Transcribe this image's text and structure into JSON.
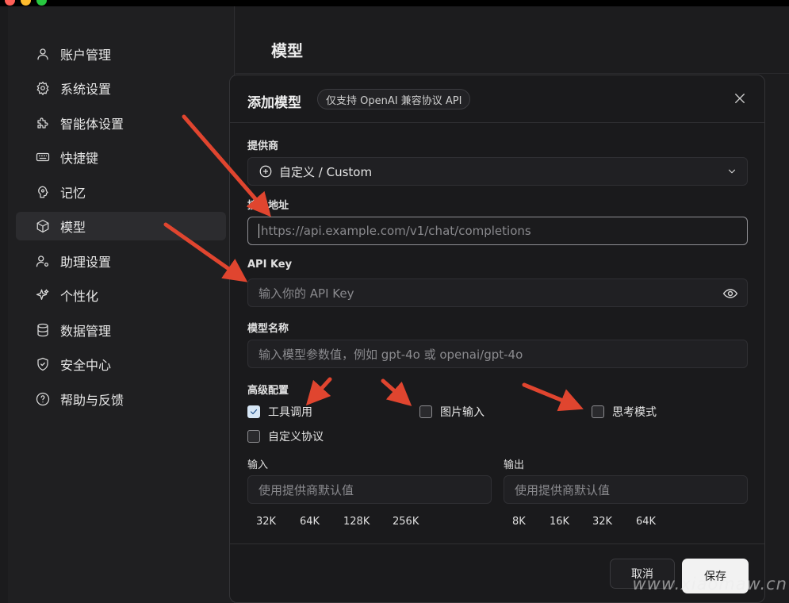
{
  "sidebar": {
    "items": [
      {
        "label": "账户管理",
        "icon": "user-icon"
      },
      {
        "label": "系统设置",
        "icon": "gear-icon"
      },
      {
        "label": "智能体设置",
        "icon": "puzzle-icon"
      },
      {
        "label": "快捷键",
        "icon": "keyboard-icon"
      },
      {
        "label": "记忆",
        "icon": "brain-icon"
      },
      {
        "label": "模型",
        "icon": "cube-icon"
      },
      {
        "label": "助理设置",
        "icon": "user-gear-icon"
      },
      {
        "label": "个性化",
        "icon": "sparkles-icon"
      },
      {
        "label": "数据管理",
        "icon": "database-icon"
      },
      {
        "label": "安全中心",
        "icon": "shield-icon"
      },
      {
        "label": "帮助与反馈",
        "icon": "help-icon"
      }
    ],
    "active_index": 5
  },
  "main": {
    "title": "模型"
  },
  "modal": {
    "title": "添加模型",
    "badge": "仅支持 OpenAI 兼容协议 API",
    "provider": {
      "label": "提供商",
      "value": "自定义 / Custom"
    },
    "endpoint": {
      "label": "接口地址",
      "placeholder": "https://api.example.com/v1/chat/completions"
    },
    "api_key": {
      "label": "API Key",
      "placeholder": "输入你的 API Key"
    },
    "model_name": {
      "label": "模型名称",
      "placeholder": "输入模型参数值，例如 gpt-4o 或 openai/gpt-4o"
    },
    "advanced": {
      "label": "高级配置",
      "options": [
        {
          "label": "工具调用",
          "checked": true
        },
        {
          "label": "图片输入",
          "checked": false
        },
        {
          "label": "思考模式",
          "checked": false
        },
        {
          "label": "自定义协议",
          "checked": false
        }
      ]
    },
    "input": {
      "label": "输入",
      "placeholder": "使用提供商默认值",
      "presets": [
        "32K",
        "64K",
        "128K",
        "256K"
      ]
    },
    "output": {
      "label": "输出",
      "placeholder": "使用提供商默认值",
      "presets": [
        "8K",
        "16K",
        "32K",
        "64K"
      ]
    },
    "cancel_label": "取消",
    "save_label": "保存"
  },
  "colors": {
    "annotation_arrow": "#e0452f",
    "checkbox_checked": "#d6e6f5"
  },
  "watermark": "www.xiaomaw.cn"
}
